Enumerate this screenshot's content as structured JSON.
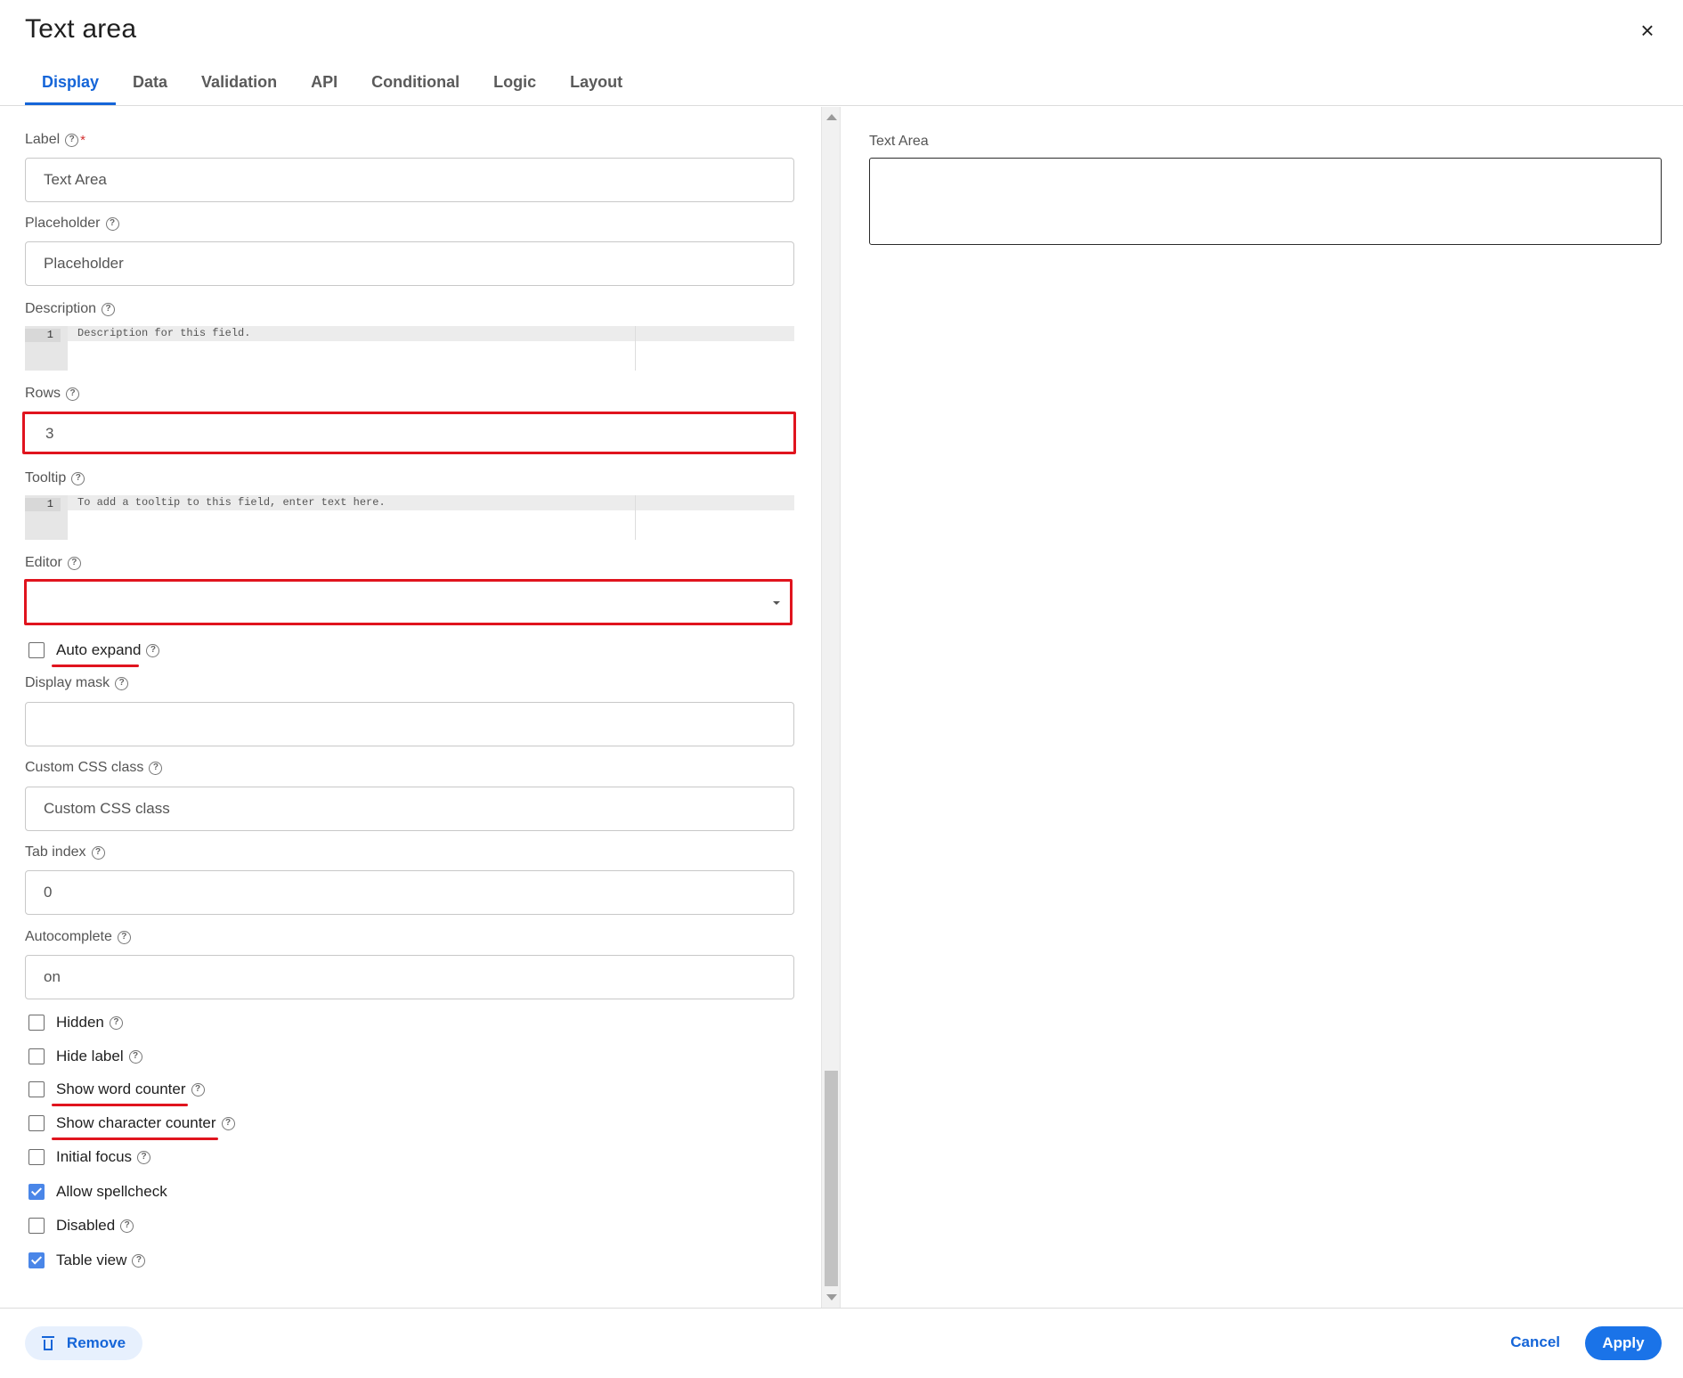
{
  "window": {
    "title": "Text area",
    "close_icon": "×"
  },
  "tabs": [
    {
      "label": "Display",
      "active": true
    },
    {
      "label": "Data"
    },
    {
      "label": "Validation"
    },
    {
      "label": "API"
    },
    {
      "label": "Conditional"
    },
    {
      "label": "Logic"
    },
    {
      "label": "Layout"
    }
  ],
  "form": {
    "label": {
      "label": "Label",
      "required_mark": "*",
      "value": "Text Area"
    },
    "placeholder": {
      "label": "Placeholder",
      "placeholder": "Placeholder"
    },
    "description": {
      "label": "Description",
      "line_number": "1",
      "code": "Description for this field."
    },
    "rows": {
      "label": "Rows",
      "value": "3"
    },
    "tooltip": {
      "label": "Tooltip",
      "line_number": "1",
      "code": "To add a tooltip to this field, enter text here."
    },
    "editor": {
      "label": "Editor",
      "value": ""
    },
    "auto_expand": {
      "label": "Auto expand",
      "checked": false
    },
    "display_mask": {
      "label": "Display mask",
      "value": ""
    },
    "custom_css": {
      "label": "Custom CSS class",
      "placeholder": "Custom CSS class"
    },
    "tab_index": {
      "label": "Tab index",
      "placeholder": "0"
    },
    "autocomplete": {
      "label": "Autocomplete",
      "placeholder": "on"
    },
    "checkboxes": [
      {
        "label": "Hidden",
        "checked": false
      },
      {
        "label": "Hide label",
        "checked": false
      },
      {
        "label": "Show word counter",
        "checked": false
      },
      {
        "label": "Show character counter",
        "checked": false
      },
      {
        "label": "Initial focus",
        "checked": false
      },
      {
        "label": "Allow spellcheck",
        "checked": true
      },
      {
        "label": "Disabled",
        "checked": false
      },
      {
        "label": "Table view",
        "checked": true
      }
    ]
  },
  "preview": {
    "label": "Text Area"
  },
  "footer": {
    "remove_label": "Remove",
    "cancel_label": "Cancel",
    "apply_label": "Apply"
  },
  "colors": {
    "accent": "#1565d8",
    "annotation_red": "#e0141e",
    "checkbox_checked": "#4a86e8"
  }
}
